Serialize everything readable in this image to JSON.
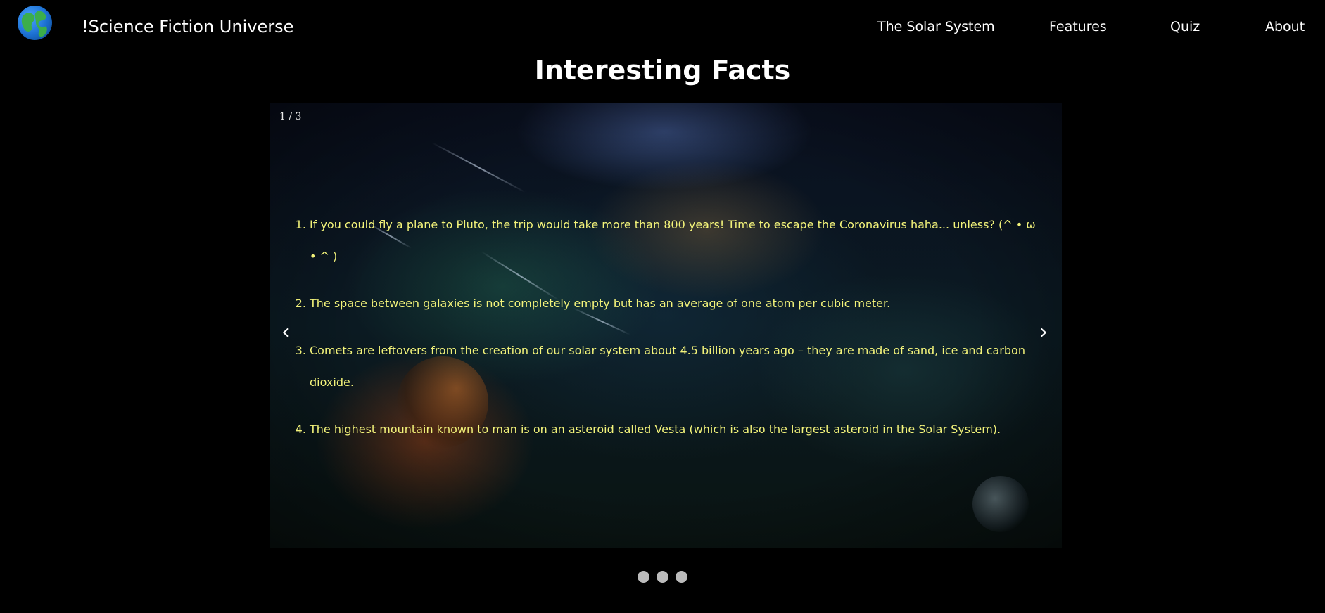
{
  "header": {
    "logo_icon": "earth-globe-icon",
    "site_title": "!Science Fiction Universe",
    "nav": [
      {
        "label": "The Solar System"
      },
      {
        "label": "Features"
      },
      {
        "label": "Quiz"
      },
      {
        "label": "About"
      }
    ]
  },
  "main": {
    "title": "Interesting Facts",
    "slideshow": {
      "counter": "1 / 3",
      "prev_label": "‹",
      "next_label": "›",
      "facts": [
        "If you could fly a plane to Pluto, the trip would take more than 800 years! Time to escape the Coronavirus haha... unless? (^ • ω • ^ )",
        "The space between galaxies is not completely empty but has an average of one atom per cubic meter.",
        "Comets are leftovers from the creation of our solar system about 4.5 billion years ago – they are made of sand, ice and carbon dioxide.",
        "The highest mountain known to man is on an asteroid called Vesta (which is also the largest asteroid in the Solar System)."
      ],
      "text_color": "#f3f37a",
      "dot_count": 3,
      "active_slide": 1
    }
  }
}
